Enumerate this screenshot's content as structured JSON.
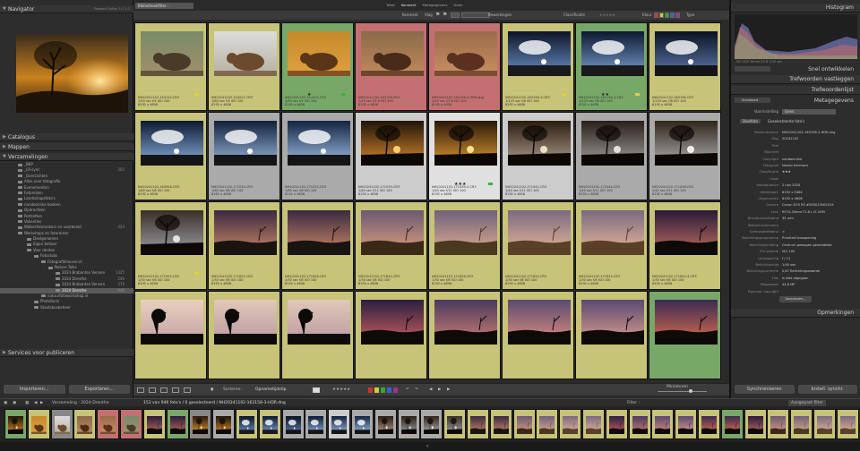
{
  "app": {
    "module": "Bibliotheekfilter :"
  },
  "left": {
    "navigator_title": "Navigator",
    "navigator_opts": "Passend  Vullen  1:1  1:2",
    "catalog_title": "Catalogus",
    "folders_title": "Mappen",
    "collections_title": "Verzamelingen",
    "publish_title": "Services voor publiceren",
    "import_label": "Importeren...",
    "export_label": "Exporteren...",
    "collections": [
      {
        "name": "_BKP",
        "count": ""
      },
      {
        "name": "_LR-sync",
        "count": "205"
      },
      {
        "name": "_Overzichten",
        "count": ""
      },
      {
        "name": "Alles over fotografie",
        "count": ""
      },
      {
        "name": "Evenementen",
        "count": ""
      },
      {
        "name": "Fotoreizen",
        "count": ""
      },
      {
        "name": "Landschapsfoto's",
        "count": ""
      },
      {
        "name": "nandoonline boeken",
        "count": ""
      },
      {
        "name": "Opdrachten",
        "count": ""
      },
      {
        "name": "Portretten",
        "count": ""
      },
      {
        "name": "Vakanties",
        "count": ""
      },
      {
        "name": "Walkerfotomakers en voorbeeld",
        "count": "424"
      },
      {
        "name": "Workshops en fotoreizen",
        "count": ""
      },
      {
        "name": "Deelgenomen",
        "count": ""
      },
      {
        "name": "Eigen behoor",
        "count": ""
      },
      {
        "name": "Voor derden",
        "count": ""
      },
      {
        "name": "Fotoclubs",
        "count": ""
      },
      {
        "name": "Fotografikheuvel.nl",
        "count": ""
      },
      {
        "name": "Nature Talks",
        "count": ""
      },
      {
        "name": "2023 Brabantse Vennen",
        "count": "1325"
      },
      {
        "name": "2024 Drenthe",
        "count": "246"
      },
      {
        "name": "2024 Brabantse Vennen",
        "count": "276"
      },
      {
        "name": "2024 Drenthe",
        "count": "946"
      },
      {
        "name": "natuurfotoworkshop.nl",
        "count": ""
      },
      {
        "name": "Photofects",
        "count": ""
      },
      {
        "name": "Staatsbosbeheer",
        "count": ""
      }
    ]
  },
  "center": {
    "filter_tabs": [
      "Tekst",
      "Kenmerk",
      "Metagegevens",
      "Geen"
    ],
    "filterbar": {
      "kenmerk_label": "Kenmerk",
      "vlag_label": "Vlag",
      "bewerking_label": "Bewerkingen",
      "classificatie_label": "Classificatie",
      "kleur_label": "Kleur",
      "type_label": "Type"
    },
    "toolbar": {
      "sort_label": "Sorteren:",
      "sort_value": "Opnametijdstip",
      "thumbs_label": "Miniaturen"
    },
    "cells": [
      {
        "file": "NH20241102-154124-CR3",
        "info": "1/50 sec f/4 ISO 100",
        "dims": "8192 x 4608",
        "stars": "",
        "label": "yellow",
        "photo": "cow1"
      },
      {
        "file": "NH20241102-154222-CR3",
        "info": "1/80 sec f/5 ISO 100",
        "dims": "8192 x 4608",
        "stars": "",
        "label": "",
        "photo": "cow2"
      },
      {
        "file": "NH20241102-154322-CR3",
        "info": "1/50 sec f/4 ISO 100",
        "dims": "8192 x 4608",
        "stars": "★",
        "label": "green",
        "photo": "cow3"
      },
      {
        "file": "NH20241102-163158-CR3",
        "info": "1/40 sec f/2.8 ISO 400",
        "dims": "8192 x 4608",
        "stars": "",
        "label": "",
        "photo": "cow4"
      },
      {
        "file": "NH20241102-163158-3-HDR.dng",
        "info": "1/40 sec f/2.8 ISO 400",
        "dims": "8192 x 4608",
        "stars": "",
        "label": "",
        "photo": "cow5"
      },
      {
        "file": "NH20241102-163156-3-CR3",
        "info": "1/125 sec f/8 ISO 100",
        "dims": "8192 x 4608",
        "stars": "",
        "label": "yellow",
        "photo": "sky1"
      },
      {
        "file": "NH20241102-163156-4-CR3",
        "info": "1/125 sec f/8 ISO 100",
        "dims": "8192 x 4608",
        "stars": "★★",
        "label": "yellow",
        "photo": "sky2"
      },
      {
        "file": "NH20241102-163156-CR3",
        "info": "1/125 sec f/8 ISO 100",
        "dims": "8192 x 4608",
        "stars": "",
        "label": "",
        "photo": "sky3"
      },
      {
        "file": "NH20241102-163928-CR3",
        "info": "1/60 sec f/8 ISO 100",
        "dims": "8192 x 4608",
        "stars": "",
        "label": "",
        "photo": "sky4"
      },
      {
        "file": "NH20241102-171030-CR3",
        "info": "1/60 sec f/8 ISO 100",
        "dims": "8192 x 4608",
        "stars": "",
        "label": "",
        "photo": "sky5"
      },
      {
        "file": "NH20241102-171032-CR3",
        "info": "1/60 sec f/8 ISO 100",
        "dims": "8192 x 4608",
        "stars": "",
        "label": "",
        "photo": "sky6"
      },
      {
        "file": "NH20241102-171039-CR3",
        "info": "1/40 sec f/11 ISO 100",
        "dims": "8192 x 4608",
        "stars": "",
        "label": "",
        "photo": "tree1"
      },
      {
        "file": "NH20241102-171039-2-CR3",
        "info": "1/40 sec f/11 ISO 100",
        "dims": "8192 x 4608",
        "stars": "★★★",
        "label": "green",
        "photo": "tree2"
      },
      {
        "file": "NH20241102-171042-CR3",
        "info": "1/40 sec f/11 ISO 100",
        "dims": "8192 x 4608",
        "stars": "",
        "label": "",
        "photo": "tree3"
      },
      {
        "file": "NH20241102-171044-CR3",
        "info": "1/40 sec f/11 ISO 100",
        "dims": "8192 x 4608",
        "stars": "",
        "label": "",
        "photo": "tree4"
      },
      {
        "file": "NH20241102-171046-CR3",
        "info": "1/40 sec f/11 ISO 100",
        "dims": "8192 x 4608",
        "stars": "",
        "label": "",
        "photo": "tree5"
      },
      {
        "file": "NH20241102-171505-CR3",
        "info": "1/30 sec f/8 ISO 100",
        "dims": "8192 x 4608",
        "stars": "",
        "label": "yellow",
        "photo": "tree6"
      },
      {
        "file": "NH20241102-171822-CR3",
        "info": "1/30 sec f/8 ISO 100",
        "dims": "8192 x 4608",
        "stars": "",
        "label": "",
        "photo": "dusk1"
      },
      {
        "file": "NH20241102-171826-CR3",
        "info": "1/30 sec f/8 ISO 100",
        "dims": "8192 x 4608",
        "stars": "",
        "label": "",
        "photo": "dusk2"
      },
      {
        "file": "NH20241102-171824-CR3",
        "info": "1/30 sec f/8 ISO 100",
        "dims": "8192 x 4608",
        "stars": "",
        "label": "",
        "photo": "dusk3"
      },
      {
        "file": "NH20241102-171826-CR3",
        "info": "1/30 sec f/8 ISO 100",
        "dims": "8192 x 4608",
        "stars": "",
        "label": "",
        "photo": "dusk4"
      },
      {
        "file": "NH20241102-171824-CR3",
        "info": "1/30 sec f/8 ISO 100",
        "dims": "8192 x 4608",
        "stars": "",
        "label": "",
        "photo": "dusk5"
      },
      {
        "file": "NH20241102-171825-CR3",
        "info": "1/30 sec f/8 ISO 100",
        "dims": "8192 x 4608",
        "stars": "",
        "label": "",
        "photo": "dusk6"
      },
      {
        "file": "NH20241102-171824-3-CR3",
        "info": "1/30 sec f/8 ISO 100",
        "dims": "8192 x 4608",
        "stars": "",
        "label": "",
        "photo": "dusk7"
      },
      {
        "file": "",
        "info": "",
        "dims": "",
        "stars": "",
        "label": "",
        "photo": "sil1"
      },
      {
        "file": "",
        "info": "",
        "dims": "",
        "stars": "",
        "label": "",
        "photo": "sil2"
      },
      {
        "file": "",
        "info": "",
        "dims": "",
        "stars": "",
        "label": "",
        "photo": "sil3"
      },
      {
        "file": "",
        "info": "",
        "dims": "",
        "stars": "",
        "label": "",
        "photo": "sil4"
      },
      {
        "file": "",
        "info": "",
        "dims": "",
        "stars": "",
        "label": "",
        "photo": "sil5"
      },
      {
        "file": "",
        "info": "",
        "dims": "",
        "stars": "",
        "label": "",
        "photo": "sil6"
      },
      {
        "file": "",
        "info": "",
        "dims": "",
        "stars": "",
        "label": "",
        "photo": "sil7"
      },
      {
        "file": "",
        "info": "",
        "dims": "",
        "stars": "",
        "label": "",
        "photo": "sil8"
      }
    ]
  },
  "right": {
    "histogram_title": "Histogram",
    "hist_info": "ISO 400   35mm   f/2.8   1/40 sec",
    "quick_dev_title": "Snel ontwikkelen",
    "keywording_title": "Trefwoorden vastleggen",
    "keyword_list_title": "Trefwoordenlijst",
    "metadata_title": "Metagegevens",
    "comments_title": "Opmerkingen",
    "preset_label": "Standaard",
    "voorinstelling_label": "Voorinstelling",
    "voorinstelling_value": "Geen",
    "tab_file": "Doelfoto",
    "tab_selected": "Geselecteerde foto's",
    "sync_label": "Synchroniseren",
    "sync_settings_label": "Instell. synchr.",
    "metadata": [
      {
        "label": "Bestandsnaam",
        "value": "NH20241102-163158-3-HDR.dng"
      },
      {
        "label": "Map",
        "value": "20241102"
      },
      {
        "label": "Titel",
        "value": ""
      },
      {
        "label": "Bijschrift",
        "value": ""
      },
      {
        "label": "Copyright",
        "value": "nandoonline"
      },
      {
        "label": "Fotograaf",
        "value": "Nando Harmsen"
      },
      {
        "label": "Classificatie",
        "value": "★★★"
      },
      {
        "label": "Label",
        "value": ""
      },
      {
        "label": "Vastlegdatum",
        "value": "2 nov 2024"
      },
      {
        "label": "Afmetingen",
        "value": "8192 x 5464"
      },
      {
        "label": "Uitgesneden",
        "value": "8192 x 4608"
      },
      {
        "label": "Camera",
        "value": "Canon EOS R5 #093023002519"
      },
      {
        "label": "Lens",
        "value": "RF15-35mm F2.8 L IS USM"
      },
      {
        "label": "Brandpuntsafstand",
        "value": "35 mm"
      },
      {
        "label": "Afstand onderwerp",
        "value": ""
      },
      {
        "label": "Scherpstelafstand",
        "value": "∞"
      },
      {
        "label": "Belichtingsprogramma",
        "value": "Prioriteit lensopening"
      },
      {
        "label": "Belichtingsmeting",
        "value": "Centrum gewogen gemiddelde"
      },
      {
        "label": "ISO-waarde",
        "value": "ISO 100"
      },
      {
        "label": "Lensopening",
        "value": "f / 11"
      },
      {
        "label": "Belichtingstijd",
        "value": "1/40 sec"
      },
      {
        "label": "Belichtingscorrectie",
        "value": "0,67 Belichtingswaarde"
      },
      {
        "label": "Flits",
        "value": "Is Niet afgegaan"
      },
      {
        "label": "Megapixels",
        "value": "44,8 MP"
      },
      {
        "label": "Eigenaar copyright",
        "value": ""
      }
    ],
    "customize_label": "Aanpassen..."
  },
  "filmstrip": {
    "collection_path": "Verzameling : 2024-Drenthe",
    "count_text": "153 van 946 foto's / 6 geselecteerd / NH20241102-163158-3-HDR.dng",
    "filter_label": "Filter :",
    "filter_value": "Aangepast filter"
  }
}
